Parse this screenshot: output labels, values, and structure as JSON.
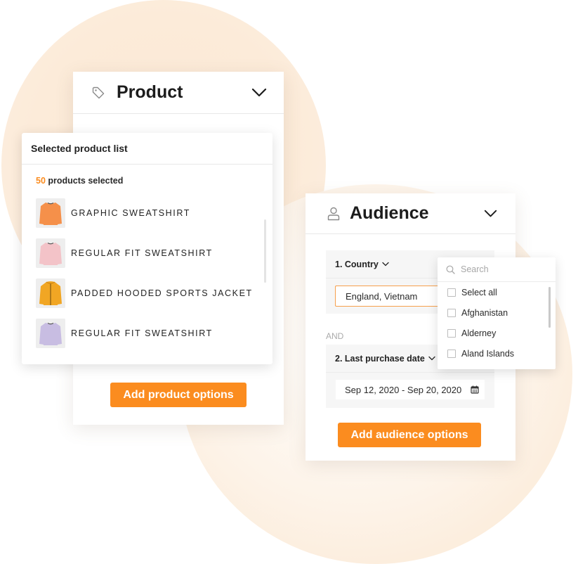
{
  "colors": {
    "accent": "#fb8c1f",
    "input_focus_border": "#f6a04d",
    "background_blob": "#fbe9d6"
  },
  "product_card": {
    "title": "Product",
    "icon": "tag-icon",
    "collapse_icon": "chevron-down-icon",
    "add_button_label": "Add product options"
  },
  "selected_list": {
    "title": "Selected product list",
    "count": "50",
    "count_suffix": "products selected",
    "items": [
      {
        "name": "GRAPHIC SWEATSHIRT",
        "thumb_color": "#f5904a",
        "kind": "sweatshirt"
      },
      {
        "name": "REGULAR FIT SWEATSHIRT",
        "thumb_color": "#f3c3c8",
        "kind": "sweatshirt"
      },
      {
        "name": "PADDED HOODED SPORTS JACKET",
        "thumb_color": "#f1a624",
        "kind": "jacket"
      },
      {
        "name": "REGULAR FIT SWEATSHIRT",
        "thumb_color": "#c8bde2",
        "kind": "sweatshirt"
      }
    ]
  },
  "audience_card": {
    "title": "Audience",
    "icon": "user-icon",
    "collapse_icon": "chevron-down-icon",
    "filters": [
      {
        "label": "1. Country",
        "value": "England, Vietnam"
      },
      {
        "label": "2. Last purchase date",
        "value": "Sep 12, 2020 - Sep 20, 2020"
      }
    ],
    "connector": "AND",
    "add_button_label": "Add audience options"
  },
  "country_dropdown": {
    "search_placeholder": "Search",
    "options": [
      "Select all",
      "Afghanistan",
      "Alderney",
      "Aland Islands"
    ]
  }
}
